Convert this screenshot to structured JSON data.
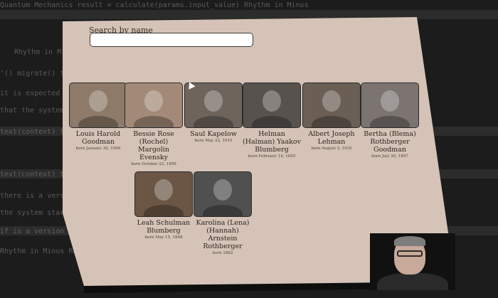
{
  "search": {
    "label": "Search by name",
    "value": "",
    "placeholder": ""
  },
  "people": [
    {
      "name": "Louis Harold Goodman",
      "born": "born January 30, 1909",
      "tone": "#8d7a69"
    },
    {
      "name": "Bessie Rose (Rochel) Margolin Evensky",
      "born": "born October 22, 1899",
      "tone": "#a38a78"
    },
    {
      "name": "Saul Kapelow",
      "born": "born May 22, 1910",
      "tone": "#6f645c"
    },
    {
      "name": "Helman (Halman) Yaakov Blumberg",
      "born": "born February 14, 1855",
      "tone": "#58524e"
    },
    {
      "name": "Albert Joseph Lehman",
      "born": "born August 3, 1935",
      "tone": "#6a5e55"
    },
    {
      "name": "Bertha (Blema) Rothberger Goodman",
      "born": "born July 20, 1897",
      "tone": "#7b7470"
    },
    {
      "name": "Leah Schulman Blumberg",
      "born": "born May 15, 1898",
      "tone": "#6b5646"
    },
    {
      "name": "Karolina (Lena) (Hannah) Arnstein Rothberger",
      "born": "born 1862",
      "tone": "#505050"
    }
  ],
  "background_code": [
    "Quantum Mechanics   result = calculate(params.input_value)   Rhythm in Minus",
    "Rhythm in Minus       the system starts.  it is expected.",
    "'() migrate()    this version is a version change",
    "it is expected format.  it should send every time.",
    "text(context)      text(context):",
    "that the system starts.  it should every time.",
    "text(context)   text(context):",
    "there is a version change   (context):",
    "the system starts.  expected format.",
    "if is a version change   '():",
    "Rhythm in Minus   Rhythm in Minus"
  ]
}
